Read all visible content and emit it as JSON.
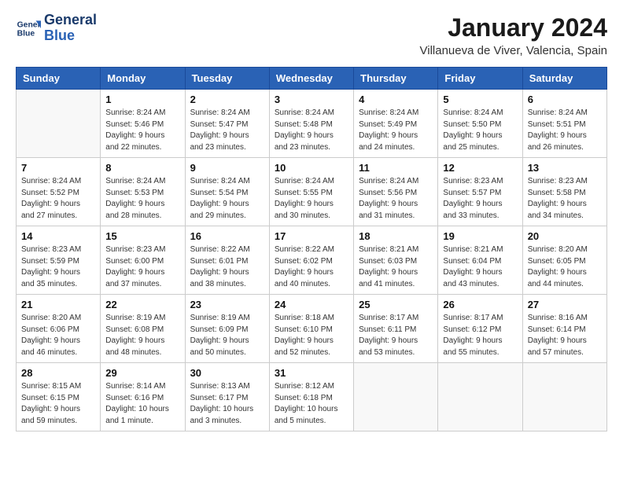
{
  "header": {
    "logo_line1": "General",
    "logo_line2": "Blue",
    "main_title": "January 2024",
    "subtitle": "Villanueva de Viver, Valencia, Spain"
  },
  "days_of_week": [
    "Sunday",
    "Monday",
    "Tuesday",
    "Wednesday",
    "Thursday",
    "Friday",
    "Saturday"
  ],
  "weeks": [
    [
      {
        "day": "",
        "info": ""
      },
      {
        "day": "1",
        "info": "Sunrise: 8:24 AM\nSunset: 5:46 PM\nDaylight: 9 hours\nand 22 minutes."
      },
      {
        "day": "2",
        "info": "Sunrise: 8:24 AM\nSunset: 5:47 PM\nDaylight: 9 hours\nand 23 minutes."
      },
      {
        "day": "3",
        "info": "Sunrise: 8:24 AM\nSunset: 5:48 PM\nDaylight: 9 hours\nand 23 minutes."
      },
      {
        "day": "4",
        "info": "Sunrise: 8:24 AM\nSunset: 5:49 PM\nDaylight: 9 hours\nand 24 minutes."
      },
      {
        "day": "5",
        "info": "Sunrise: 8:24 AM\nSunset: 5:50 PM\nDaylight: 9 hours\nand 25 minutes."
      },
      {
        "day": "6",
        "info": "Sunrise: 8:24 AM\nSunset: 5:51 PM\nDaylight: 9 hours\nand 26 minutes."
      }
    ],
    [
      {
        "day": "7",
        "info": "Sunrise: 8:24 AM\nSunset: 5:52 PM\nDaylight: 9 hours\nand 27 minutes."
      },
      {
        "day": "8",
        "info": "Sunrise: 8:24 AM\nSunset: 5:53 PM\nDaylight: 9 hours\nand 28 minutes."
      },
      {
        "day": "9",
        "info": "Sunrise: 8:24 AM\nSunset: 5:54 PM\nDaylight: 9 hours\nand 29 minutes."
      },
      {
        "day": "10",
        "info": "Sunrise: 8:24 AM\nSunset: 5:55 PM\nDaylight: 9 hours\nand 30 minutes."
      },
      {
        "day": "11",
        "info": "Sunrise: 8:24 AM\nSunset: 5:56 PM\nDaylight: 9 hours\nand 31 minutes."
      },
      {
        "day": "12",
        "info": "Sunrise: 8:23 AM\nSunset: 5:57 PM\nDaylight: 9 hours\nand 33 minutes."
      },
      {
        "day": "13",
        "info": "Sunrise: 8:23 AM\nSunset: 5:58 PM\nDaylight: 9 hours\nand 34 minutes."
      }
    ],
    [
      {
        "day": "14",
        "info": "Sunrise: 8:23 AM\nSunset: 5:59 PM\nDaylight: 9 hours\nand 35 minutes."
      },
      {
        "day": "15",
        "info": "Sunrise: 8:23 AM\nSunset: 6:00 PM\nDaylight: 9 hours\nand 37 minutes."
      },
      {
        "day": "16",
        "info": "Sunrise: 8:22 AM\nSunset: 6:01 PM\nDaylight: 9 hours\nand 38 minutes."
      },
      {
        "day": "17",
        "info": "Sunrise: 8:22 AM\nSunset: 6:02 PM\nDaylight: 9 hours\nand 40 minutes."
      },
      {
        "day": "18",
        "info": "Sunrise: 8:21 AM\nSunset: 6:03 PM\nDaylight: 9 hours\nand 41 minutes."
      },
      {
        "day": "19",
        "info": "Sunrise: 8:21 AM\nSunset: 6:04 PM\nDaylight: 9 hours\nand 43 minutes."
      },
      {
        "day": "20",
        "info": "Sunrise: 8:20 AM\nSunset: 6:05 PM\nDaylight: 9 hours\nand 44 minutes."
      }
    ],
    [
      {
        "day": "21",
        "info": "Sunrise: 8:20 AM\nSunset: 6:06 PM\nDaylight: 9 hours\nand 46 minutes."
      },
      {
        "day": "22",
        "info": "Sunrise: 8:19 AM\nSunset: 6:08 PM\nDaylight: 9 hours\nand 48 minutes."
      },
      {
        "day": "23",
        "info": "Sunrise: 8:19 AM\nSunset: 6:09 PM\nDaylight: 9 hours\nand 50 minutes."
      },
      {
        "day": "24",
        "info": "Sunrise: 8:18 AM\nSunset: 6:10 PM\nDaylight: 9 hours\nand 52 minutes."
      },
      {
        "day": "25",
        "info": "Sunrise: 8:17 AM\nSunset: 6:11 PM\nDaylight: 9 hours\nand 53 minutes."
      },
      {
        "day": "26",
        "info": "Sunrise: 8:17 AM\nSunset: 6:12 PM\nDaylight: 9 hours\nand 55 minutes."
      },
      {
        "day": "27",
        "info": "Sunrise: 8:16 AM\nSunset: 6:14 PM\nDaylight: 9 hours\nand 57 minutes."
      }
    ],
    [
      {
        "day": "28",
        "info": "Sunrise: 8:15 AM\nSunset: 6:15 PM\nDaylight: 9 hours\nand 59 minutes."
      },
      {
        "day": "29",
        "info": "Sunrise: 8:14 AM\nSunset: 6:16 PM\nDaylight: 10 hours\nand 1 minute."
      },
      {
        "day": "30",
        "info": "Sunrise: 8:13 AM\nSunset: 6:17 PM\nDaylight: 10 hours\nand 3 minutes."
      },
      {
        "day": "31",
        "info": "Sunrise: 8:12 AM\nSunset: 6:18 PM\nDaylight: 10 hours\nand 5 minutes."
      },
      {
        "day": "",
        "info": ""
      },
      {
        "day": "",
        "info": ""
      },
      {
        "day": "",
        "info": ""
      }
    ]
  ]
}
